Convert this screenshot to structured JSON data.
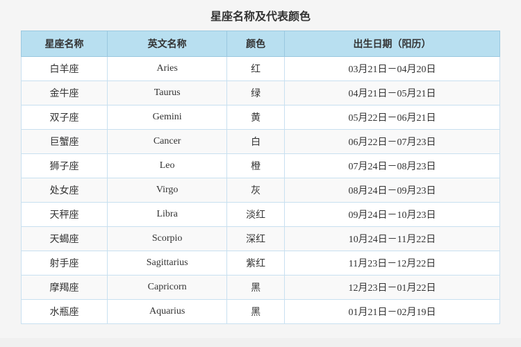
{
  "title": "星座名称及代表颜色",
  "headers": {
    "cn_name": "星座名称",
    "en_name": "英文名称",
    "color": "颜色",
    "birth_date": "出生日期（阳历）"
  },
  "rows": [
    {
      "cn": "白羊座",
      "en": "Aries",
      "color": "红",
      "date": "03月21日－04月20日"
    },
    {
      "cn": "金牛座",
      "en": "Taurus",
      "color": "绿",
      "date": "04月21日－05月21日"
    },
    {
      "cn": "双子座",
      "en": "Gemini",
      "color": "黄",
      "date": "05月22日－06月21日"
    },
    {
      "cn": "巨蟹座",
      "en": "Cancer",
      "color": "白",
      "date": "06月22日－07月23日"
    },
    {
      "cn": "狮子座",
      "en": "Leo",
      "color": "橙",
      "date": "07月24日－08月23日"
    },
    {
      "cn": "处女座",
      "en": "Virgo",
      "color": "灰",
      "date": "08月24日－09月23日"
    },
    {
      "cn": "天秤座",
      "en": "Libra",
      "color": "淡红",
      "date": "09月24日－10月23日"
    },
    {
      "cn": "天蝎座",
      "en": "Scorpio",
      "color": "深红",
      "date": "10月24日－11月22日"
    },
    {
      "cn": "射手座",
      "en": "Sagittarius",
      "color": "紫红",
      "date": "11月23日－12月22日"
    },
    {
      "cn": "摩羯座",
      "en": "Capricorn",
      "color": "黑",
      "date": "12月23日－01月22日"
    },
    {
      "cn": "水瓶座",
      "en": "Aquarius",
      "color": "黑",
      "date": "01月21日－02月19日"
    }
  ]
}
